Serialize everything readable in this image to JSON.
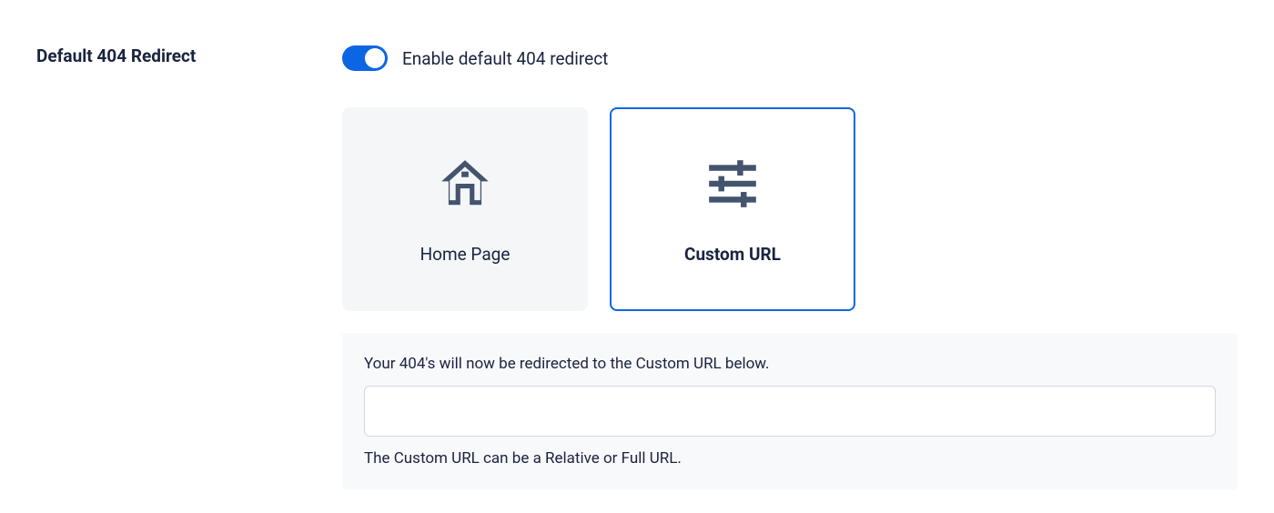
{
  "section": {
    "title": "Default 404 Redirect"
  },
  "toggle": {
    "label": "Enable default 404 redirect",
    "enabled": true
  },
  "options": {
    "home_page": {
      "label": "Home Page",
      "icon": "home-icon",
      "selected": false
    },
    "custom_url": {
      "label": "Custom URL",
      "icon": "sliders-icon",
      "selected": true
    }
  },
  "custom_url_panel": {
    "description": "Your 404's will now be redirected to the Custom URL below.",
    "input_value": "",
    "input_placeholder": "",
    "hint": "The Custom URL can be a Relative or Full URL."
  }
}
